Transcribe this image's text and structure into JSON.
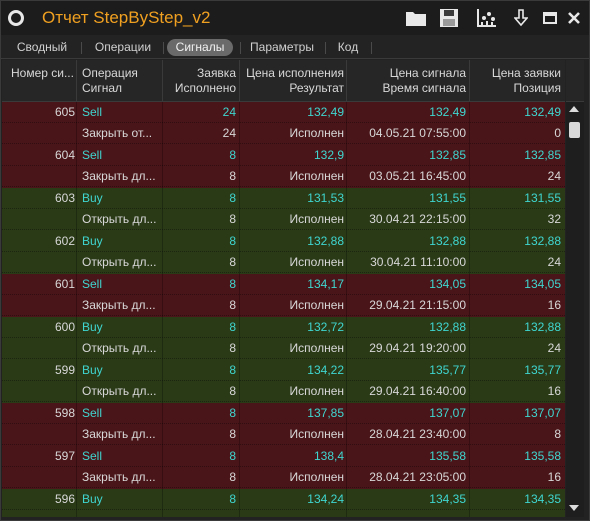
{
  "window": {
    "title": "Отчет StepByStep_v2"
  },
  "toolbar": {
    "open_icon": "folder-icon",
    "save_icon": "save-icon",
    "chart_icon": "chart-settings-icon",
    "download_icon": "download-arrow-icon",
    "maximize_icon": "maximize-icon",
    "close_icon": "close-icon"
  },
  "tabs": [
    {
      "label": "Сводный",
      "active": false
    },
    {
      "label": "Операции",
      "active": false
    },
    {
      "label": "Сигналы",
      "active": true
    },
    {
      "label": "Параметры",
      "active": false
    },
    {
      "label": "Код",
      "active": false
    }
  ],
  "columns": {
    "num": "Номер си...",
    "op1": "Операция",
    "op2": "Сигнал",
    "qty1": "Заявка",
    "qty2": "Исполнено",
    "price1": "Цена исполнения",
    "price2": "Результат",
    "sig1": "Цена сигнала",
    "sig2": "Время сигнала",
    "pos1": "Цена заявки",
    "pos2": "Позиция"
  },
  "colors": {
    "sell_bg": "#4a1519",
    "buy_bg": "#2a3a17",
    "accent": "#3fd6d0",
    "title": "#f0a020"
  },
  "signals": [
    {
      "num": "605",
      "op": "Sell",
      "type": "sell",
      "qty": "24",
      "price": "132,49",
      "sig_price": "132,49",
      "order_price": "132,49",
      "signal": "Закрыть от...",
      "filled": "24",
      "result": "Исполнен",
      "time": "04.05.21 07:55:00",
      "position": "0"
    },
    {
      "num": "604",
      "op": "Sell",
      "type": "sell",
      "qty": "8",
      "price": "132,9",
      "sig_price": "132,85",
      "order_price": "132,85",
      "signal": "Закрыть дл...",
      "filled": "8",
      "result": "Исполнен",
      "time": "03.05.21 16:45:00",
      "position": "24"
    },
    {
      "num": "603",
      "op": "Buy",
      "type": "buy",
      "qty": "8",
      "price": "131,53",
      "sig_price": "131,55",
      "order_price": "131,55",
      "signal": "Открыть дл...",
      "filled": "8",
      "result": "Исполнен",
      "time": "30.04.21 22:15:00",
      "position": "32"
    },
    {
      "num": "602",
      "op": "Buy",
      "type": "buy",
      "qty": "8",
      "price": "132,88",
      "sig_price": "132,88",
      "order_price": "132,88",
      "signal": "Открыть дл...",
      "filled": "8",
      "result": "Исполнен",
      "time": "30.04.21 11:10:00",
      "position": "24"
    },
    {
      "num": "601",
      "op": "Sell",
      "type": "sell",
      "qty": "8",
      "price": "134,17",
      "sig_price": "134,05",
      "order_price": "134,05",
      "signal": "Закрыть дл...",
      "filled": "8",
      "result": "Исполнен",
      "time": "29.04.21 21:15:00",
      "position": "16"
    },
    {
      "num": "600",
      "op": "Buy",
      "type": "buy",
      "qty": "8",
      "price": "132,72",
      "sig_price": "132,88",
      "order_price": "132,88",
      "signal": "Открыть дл...",
      "filled": "8",
      "result": "Исполнен",
      "time": "29.04.21 19:20:00",
      "position": "24"
    },
    {
      "num": "599",
      "op": "Buy",
      "type": "buy",
      "qty": "8",
      "price": "134,22",
      "sig_price": "135,77",
      "order_price": "135,77",
      "signal": "Открыть дл...",
      "filled": "8",
      "result": "Исполнен",
      "time": "29.04.21 16:40:00",
      "position": "16"
    },
    {
      "num": "598",
      "op": "Sell",
      "type": "sell",
      "qty": "8",
      "price": "137,85",
      "sig_price": "137,07",
      "order_price": "137,07",
      "signal": "Закрыть дл...",
      "filled": "8",
      "result": "Исполнен",
      "time": "28.04.21 23:40:00",
      "position": "8"
    },
    {
      "num": "597",
      "op": "Sell",
      "type": "sell",
      "qty": "8",
      "price": "138,4",
      "sig_price": "135,58",
      "order_price": "135,58",
      "signal": "Закрыть дл...",
      "filled": "8",
      "result": "Исполнен",
      "time": "28.04.21 23:05:00",
      "position": "16"
    },
    {
      "num": "596",
      "op": "Buy",
      "type": "buy",
      "qty": "8",
      "price": "134,24",
      "sig_price": "134,35",
      "order_price": "134,35",
      "signal": "",
      "filled": "",
      "result": "",
      "time": "",
      "position": ""
    }
  ]
}
